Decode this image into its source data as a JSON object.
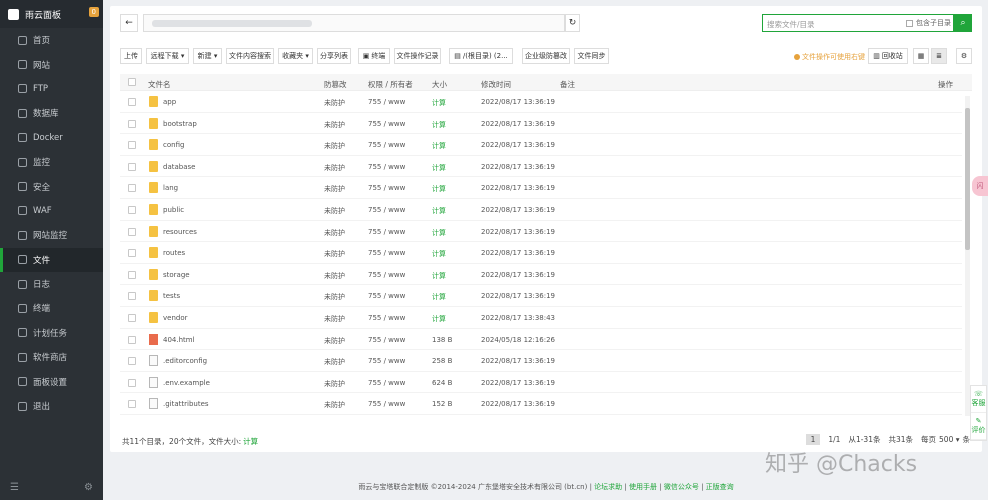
{
  "sidebar": {
    "brand": "雨云面板",
    "badge": "0",
    "items": [
      {
        "label": "首页",
        "icon": "home-icon"
      },
      {
        "label": "网站",
        "icon": "globe-icon"
      },
      {
        "label": "FTP",
        "icon": "ftp-icon"
      },
      {
        "label": "数据库",
        "icon": "database-icon"
      },
      {
        "label": "Docker",
        "icon": "docker-icon"
      },
      {
        "label": "监控",
        "icon": "monitor-icon"
      },
      {
        "label": "安全",
        "icon": "shield-icon"
      },
      {
        "label": "WAF",
        "icon": "firewall-icon"
      },
      {
        "label": "网站监控",
        "icon": "site-monitor-icon"
      },
      {
        "label": "文件",
        "icon": "folder-icon"
      },
      {
        "label": "日志",
        "icon": "log-icon"
      },
      {
        "label": "终端",
        "icon": "terminal-icon"
      },
      {
        "label": "计划任务",
        "icon": "clock-icon"
      },
      {
        "label": "软件商店",
        "icon": "store-icon"
      },
      {
        "label": "面板设置",
        "icon": "gear-icon"
      },
      {
        "label": "退出",
        "icon": "logout-icon"
      }
    ],
    "active_index": 9
  },
  "search": {
    "placeholder": "搜索文件/目录",
    "subdir_label": "包含子目录"
  },
  "toolbar": {
    "upload": "上传",
    "remote_download": "远程下载 ▾",
    "new": "新建 ▾",
    "content_search": "文件内容搜索",
    "favorites": "收藏夹 ▾",
    "share_list": "分享列表",
    "terminal": "终端",
    "op_log": "文件操作记录",
    "root_dir": "/(根目录) (2...",
    "tamper": "企业级防篡改",
    "sync": "文件同步",
    "tip": "文件操作可使用右键",
    "recycle": "回收站"
  },
  "table": {
    "headers": {
      "name": "文件名",
      "tamper": "防篡改",
      "perm": "权限 / 所有者",
      "size": "大小",
      "mtime": "修改时间",
      "note": "备注",
      "ops": "操作"
    },
    "rows": [
      {
        "type": "folder",
        "name": "app",
        "tamper": "未防护",
        "perm": "755 / www",
        "size": "计算",
        "mtime": "2022/08/17 13:36:19"
      },
      {
        "type": "folder",
        "name": "bootstrap",
        "tamper": "未防护",
        "perm": "755 / www",
        "size": "计算",
        "mtime": "2022/08/17 13:36:19"
      },
      {
        "type": "folder",
        "name": "config",
        "tamper": "未防护",
        "perm": "755 / www",
        "size": "计算",
        "mtime": "2022/08/17 13:36:19"
      },
      {
        "type": "folder",
        "name": "database",
        "tamper": "未防护",
        "perm": "755 / www",
        "size": "计算",
        "mtime": "2022/08/17 13:36:19"
      },
      {
        "type": "folder",
        "name": "lang",
        "tamper": "未防护",
        "perm": "755 / www",
        "size": "计算",
        "mtime": "2022/08/17 13:36:19"
      },
      {
        "type": "folder",
        "name": "public",
        "tamper": "未防护",
        "perm": "755 / www",
        "size": "计算",
        "mtime": "2022/08/17 13:36:19"
      },
      {
        "type": "folder",
        "name": "resources",
        "tamper": "未防护",
        "perm": "755 / www",
        "size": "计算",
        "mtime": "2022/08/17 13:36:19"
      },
      {
        "type": "folder",
        "name": "routes",
        "tamper": "未防护",
        "perm": "755 / www",
        "size": "计算",
        "mtime": "2022/08/17 13:36:19"
      },
      {
        "type": "folder",
        "name": "storage",
        "tamper": "未防护",
        "perm": "755 / www",
        "size": "计算",
        "mtime": "2022/08/17 13:36:19"
      },
      {
        "type": "folder",
        "name": "tests",
        "tamper": "未防护",
        "perm": "755 / www",
        "size": "计算",
        "mtime": "2022/08/17 13:36:19"
      },
      {
        "type": "folder",
        "name": "vendor",
        "tamper": "未防护",
        "perm": "755 / www",
        "size": "计算",
        "mtime": "2022/08/17 13:38:43"
      },
      {
        "type": "html",
        "name": "404.html",
        "tamper": "未防护",
        "perm": "755 / www",
        "size": "138 B",
        "mtime": "2024/05/18 12:16:26"
      },
      {
        "type": "file",
        "name": ".editorconfig",
        "tamper": "未防护",
        "perm": "755 / www",
        "size": "258 B",
        "mtime": "2022/08/17 13:36:19"
      },
      {
        "type": "file",
        "name": ".env.example",
        "tamper": "未防护",
        "perm": "755 / www",
        "size": "624 B",
        "mtime": "2022/08/17 13:36:19"
      },
      {
        "type": "file",
        "name": ".gitattributes",
        "tamper": "未防护",
        "perm": "755 / www",
        "size": "152 B",
        "mtime": "2022/08/17 13:36:19"
      }
    ]
  },
  "footer": {
    "summary": "共11个目录，20个文件，文件大小:",
    "calc": "计算",
    "page": "1",
    "page_of": "1/1",
    "range": "从1-31条",
    "total": "共31条",
    "per_page": "每页",
    "per_page_value": "500 ▾",
    "unit": "条"
  },
  "copyright": {
    "text": "雨云与宝塔联合定制版 ©2014-2024 广东堡塔安全技术有限公司 (bt.cn)",
    "links": [
      "论坛求助",
      "使用手册",
      "微信公众号",
      "正版查询"
    ]
  },
  "side_tools": {
    "service": "客服",
    "review": "评价"
  },
  "float_tab": "闪",
  "watermark": "知乎 @Chacks",
  "colors": {
    "accent": "#20a53a",
    "sidebar_bg": "#2c3136",
    "warn": "#e6a23c"
  }
}
